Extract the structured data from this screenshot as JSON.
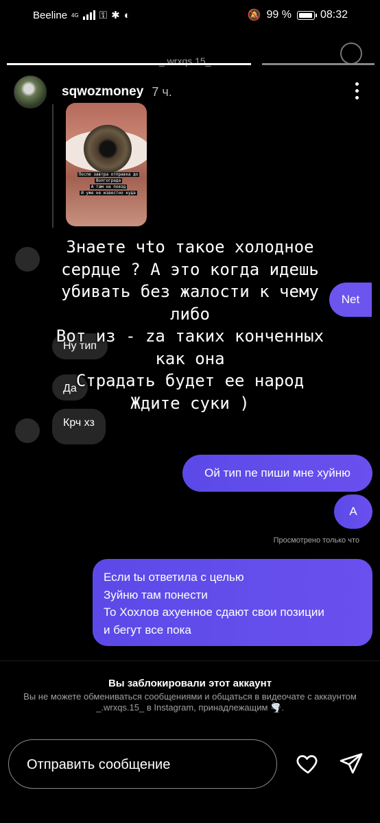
{
  "status_bar": {
    "carrier": "Beeline",
    "network": "4G",
    "battery": "99 %",
    "time": "08:32"
  },
  "header": {
    "username": "sqwozmoney",
    "time_ago": "7 ч.",
    "ghost_username": "_.wrxqs.15_"
  },
  "story_thumb_text": [
    "После завтра отправка до",
    "Волгограда",
    "А там на поезд",
    "И уже не известно куда"
  ],
  "overlay_lines": [
    "Знаете чtо такое холодное",
    "сердце ? А это когда идешь",
    "убивать без жалости к чему",
    "либо",
    "Вот из - za таких конченных",
    "как она",
    "Страдать будет ее народ",
    "Ждите суки )"
  ],
  "messages_in": [
    {
      "text": "Ну тип"
    },
    {
      "text": "Да"
    },
    {
      "text": "Крч хз"
    }
  ],
  "messages_out": [
    {
      "text": "Net"
    },
    {
      "text": "Ой тип ne пиши мне хуйню"
    },
    {
      "text": "А"
    }
  ],
  "seen_label": "Просмотрено только что",
  "long_message_lines": [
    "Если tы ответила с целью",
    "Зуйню там понести",
    "То Хохлов ахуенное сдают свои позиции",
    "и бегут все пока"
  ],
  "blocked": {
    "title": "Вы заблокировали этот аккаунт",
    "description": "Вы не можете обмениваться сообщениями и общаться в видеочате с аккаунтом _.wrxqs.15_ в Instagram, принадлежащим 🌪️."
  },
  "composer": {
    "placeholder": "Отправить сообщение"
  },
  "icons": {
    "like": "heart-icon",
    "send": "send-icon",
    "more": "more-icon"
  }
}
